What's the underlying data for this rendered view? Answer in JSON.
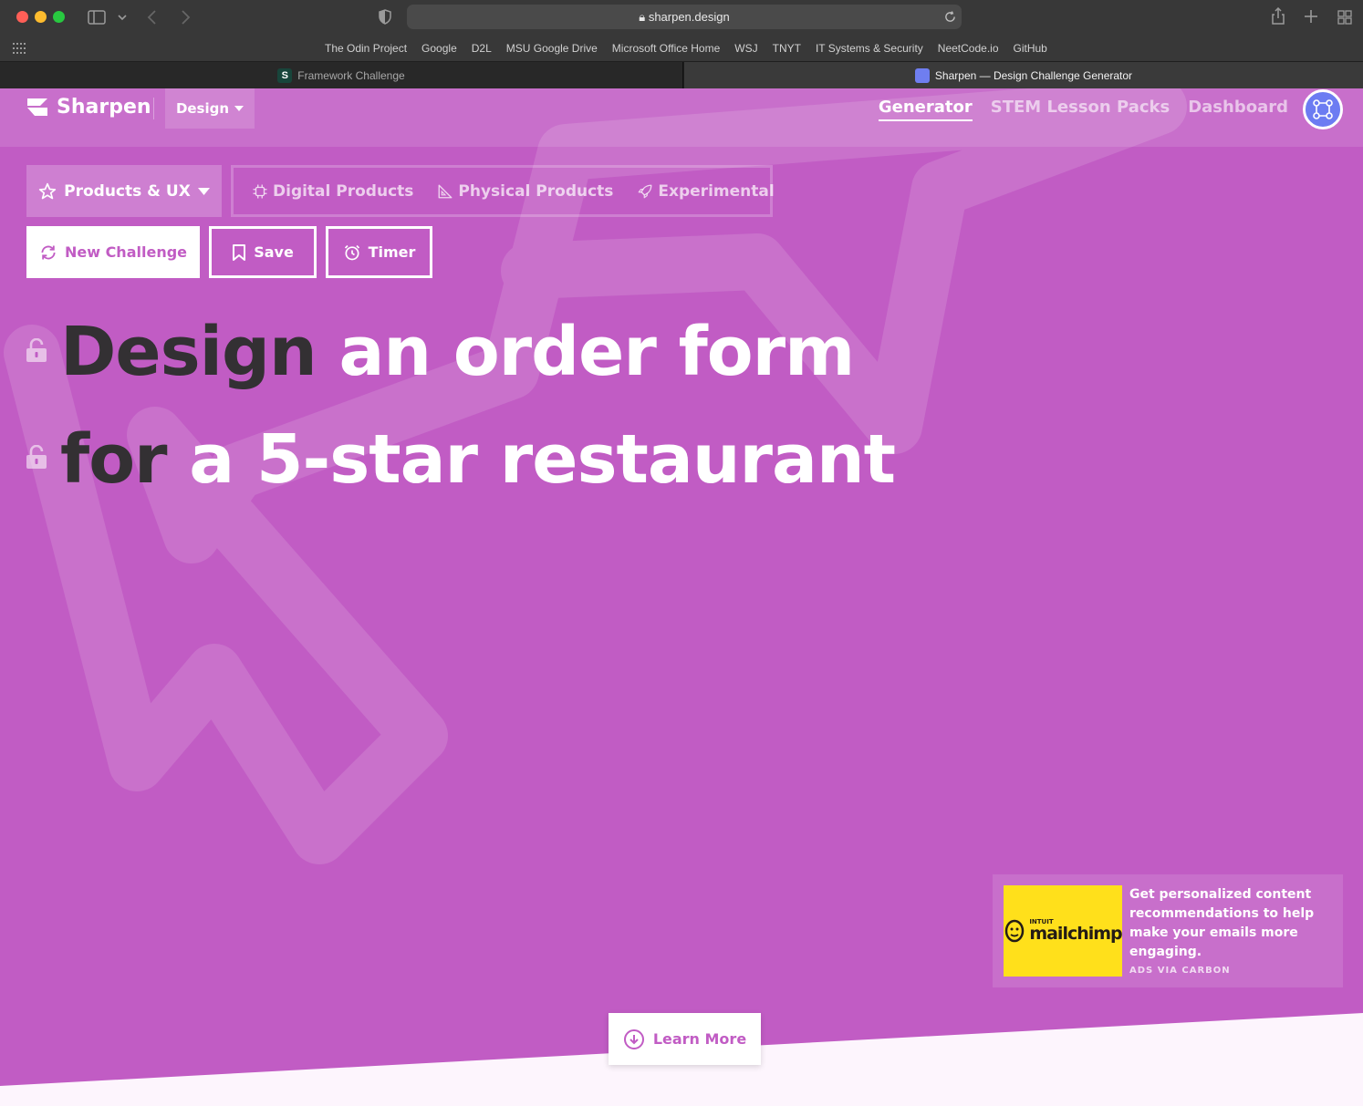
{
  "browser": {
    "url": "sharpen.design",
    "bookmarks": [
      "The Odin Project",
      "Google",
      "D2L",
      "MSU Google Drive",
      "Microsoft Office Home",
      "WSJ",
      "TNYT",
      "IT Systems & Security",
      "NeetCode.io",
      "GitHub"
    ],
    "tabs": [
      {
        "title": "Framework Challenge",
        "active": false
      },
      {
        "title": "Sharpen — Design Challenge Generator",
        "active": true
      }
    ]
  },
  "nav": {
    "brand": "Sharpen",
    "mode_dropdown": "Design",
    "links": [
      {
        "label": "Generator",
        "active": true
      },
      {
        "label": "STEM Lesson Packs",
        "active": false
      },
      {
        "label": "Dashboard",
        "active": false
      }
    ]
  },
  "categories": {
    "selected": "Products & UX",
    "subcategories": [
      "Digital Products",
      "Physical Products",
      "Experimental"
    ]
  },
  "actions": {
    "new_challenge": "New Challenge",
    "save": "Save",
    "timer": "Timer"
  },
  "challenge": {
    "line1_verb": "Design",
    "line1_rest": "an order form",
    "line2_subject": "for",
    "line2_rest": "a 5-star restaurant"
  },
  "ad": {
    "brand_small": "INTUIT",
    "brand": "mailchimp",
    "text": "Get personalized content recommendations to help make your emails more engaging.",
    "via": "ADS VIA CARBON"
  },
  "learn_more": "Learn More",
  "colors": {
    "background": "#c15cc4",
    "headline_dark": "#333033",
    "ad_yellow": "#ffe01b",
    "avatar": "#6c7cf2"
  }
}
